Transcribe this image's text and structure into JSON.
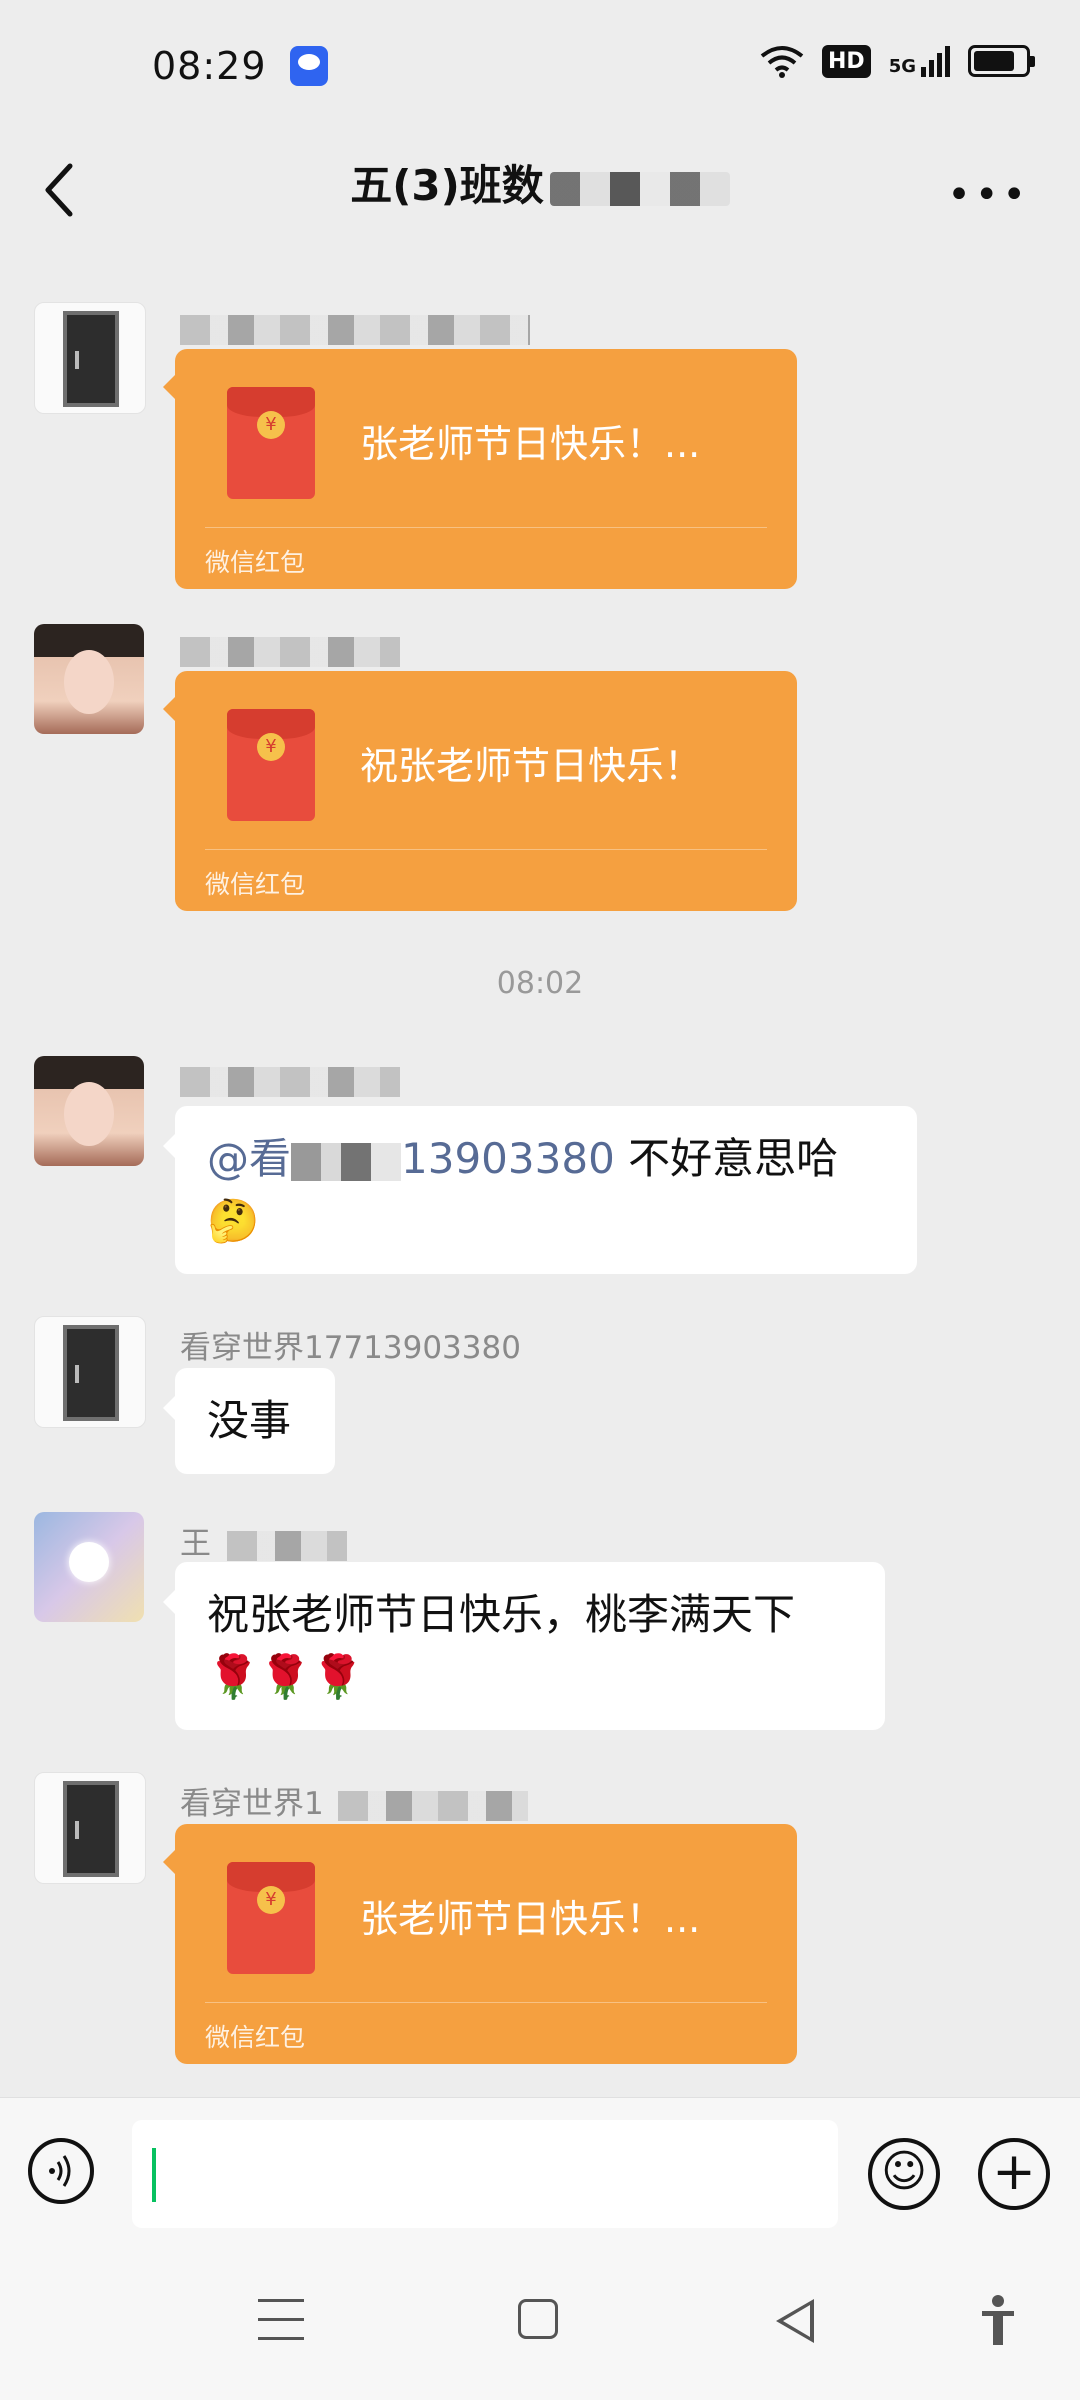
{
  "status_bar": {
    "time": "08:29",
    "hd_label": "HD",
    "signal_label": "5G"
  },
  "header": {
    "title": "五(3)班数"
  },
  "messages": [
    {
      "type": "red_packet",
      "avatar": "door-avatar",
      "text": "张老师节日快乐！...",
      "label": "微信红包"
    },
    {
      "type": "red_packet",
      "avatar": "woman-avatar",
      "text": "祝张老师节日快乐！",
      "label": "微信红包"
    },
    {
      "type": "timestamp",
      "text": "08:02"
    },
    {
      "type": "text",
      "avatar": "woman-avatar",
      "mention_prefix": "@看",
      "mention_suffix": "13903380",
      "text": " 不好意思哈🤔"
    },
    {
      "type": "text",
      "avatar": "door-avatar",
      "sender": "看穿世界17713903380",
      "text": "没事"
    },
    {
      "type": "text",
      "avatar": "flower-avatar",
      "sender": "王",
      "text": "祝张老师节日快乐，桃李满天下",
      "text2": "🌹🌹🌹"
    },
    {
      "type": "red_packet",
      "avatar": "door-avatar",
      "sender": "看穿世界1",
      "text": "张老师节日快乐！...",
      "label": "微信红包"
    }
  ],
  "composer": {
    "emoji_glyph": "☺",
    "plus_glyph": "+"
  },
  "colors": {
    "background": "#ededed",
    "red_packet": "#f5a040",
    "mention": "#576b95",
    "caret": "#07c160"
  }
}
